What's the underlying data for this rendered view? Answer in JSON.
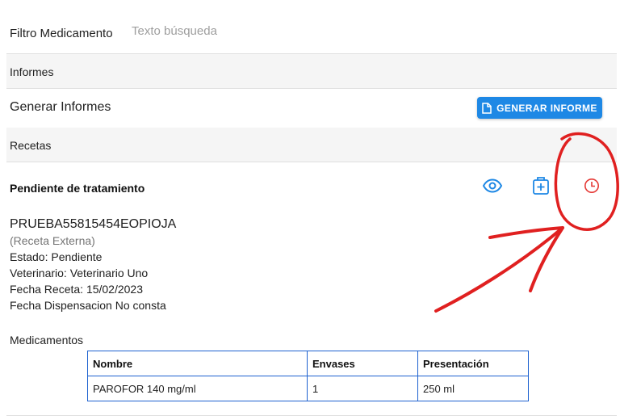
{
  "filter": {
    "label": "Filtro Medicamento",
    "placeholder": "Texto búsqueda"
  },
  "informes": {
    "header": "Informes",
    "row_label": "Generar Informes",
    "button_label": "GENERAR INFORME"
  },
  "recetas": {
    "header": "Recetas",
    "items": [
      {
        "status_title": "Pendiente de tratamiento",
        "code": "PRUEBA55815454EOPIOJA",
        "origin": "(Receta Externa)",
        "estado": "Estado: Pendiente",
        "veterinario": "Veterinario: Veterinario Uno",
        "fecha_receta": "Fecha Receta: 15/02/2023",
        "fecha_dispensacion": "Fecha Dispensacion No consta",
        "medicamentos_title": "Medicamentos",
        "table": {
          "headers": [
            "Nombre",
            "Envases",
            "Presentación"
          ],
          "rows": [
            [
              "PAROFOR 140 mg/ml",
              "1",
              "250 ml"
            ]
          ]
        },
        "actions": [
          {
            "icon": "eye-icon"
          },
          {
            "icon": "medical-bag-icon"
          },
          {
            "icon": "clock-icon"
          }
        ]
      }
    ]
  },
  "colors": {
    "primary": "#1e88e5",
    "table_border": "#1e62d0",
    "clock": "#e53935",
    "annotation": "#e02020"
  }
}
